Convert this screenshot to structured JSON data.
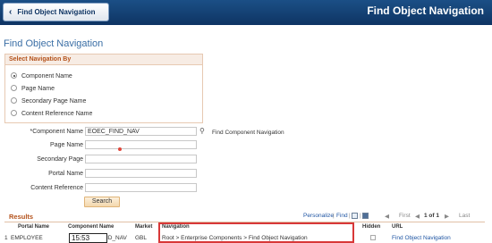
{
  "header": {
    "back_label": "Find Object Navigation",
    "title": "Find Object Navigation"
  },
  "page_title": "Find Object Navigation",
  "navigate_by": {
    "heading": "Select Navigation By",
    "options": [
      {
        "label": "Component Name",
        "selected": true
      },
      {
        "label": "Page Name",
        "selected": false
      },
      {
        "label": "Secondary Page Name",
        "selected": false
      },
      {
        "label": "Content Reference Name",
        "selected": false
      }
    ]
  },
  "fields": {
    "component_name": {
      "label": "*Component Name",
      "value": "EOEC_FIND_NAV"
    },
    "page_name": {
      "label": "Page Name",
      "value": ""
    },
    "secondary_page": {
      "label": "Secondary Page",
      "value": ""
    },
    "portal_name": {
      "label": "Portal Name",
      "value": ""
    },
    "content_reference": {
      "label": "Content Reference",
      "value": ""
    }
  },
  "find_component_link": "Find Component Navigation",
  "search_label": "Search",
  "results": {
    "title": "Results",
    "personalize": "Personalize",
    "find": "Find",
    "separator": "|",
    "first": "First",
    "pager": "1 of 1",
    "last": "Last",
    "columns": [
      "Portal Name",
      "Component Name",
      "Market",
      "Navigation",
      "Hidden",
      "URL"
    ],
    "rows": [
      {
        "num": "1",
        "portal": "EMPLOYEE",
        "component": "ND_NAV",
        "market": "GBL",
        "navigation": "Root > Enterprise Components > Find Object Navigation",
        "url": "Find Object Navigation"
      }
    ]
  },
  "overlay_time": "15:53",
  "colors": {
    "header_bg": "#0e3463",
    "accent_orange": "#b4521b",
    "link_blue": "#1f55a3",
    "highlight_red": "#d83838"
  }
}
